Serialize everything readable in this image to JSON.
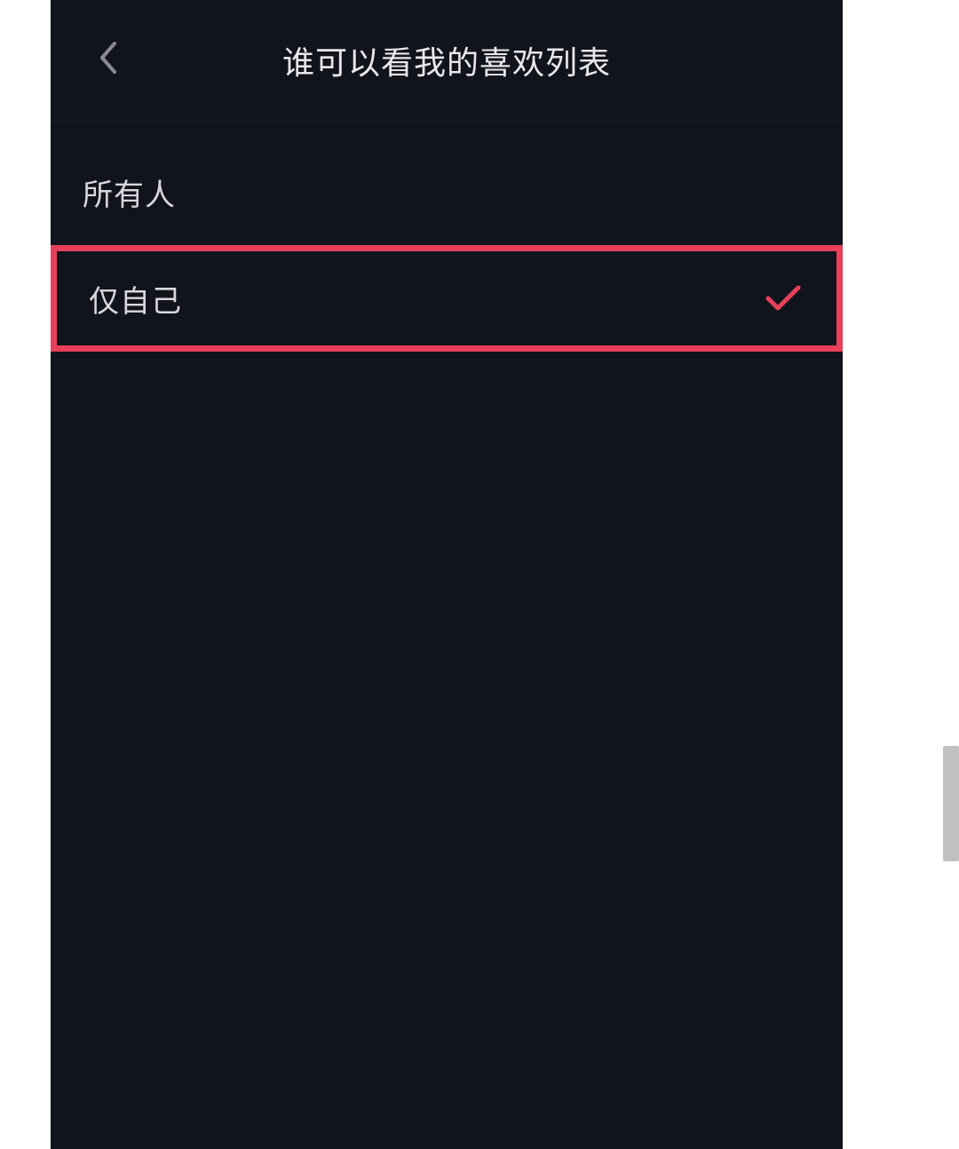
{
  "header": {
    "title": "谁可以看我的喜欢列表"
  },
  "options": {
    "everyone": {
      "label": "所有人",
      "selected": false
    },
    "only_me": {
      "label": "仅自己",
      "selected": true
    }
  },
  "colors": {
    "highlight": "#e8405a",
    "background": "#12141d",
    "text": "#d8d8dc"
  }
}
